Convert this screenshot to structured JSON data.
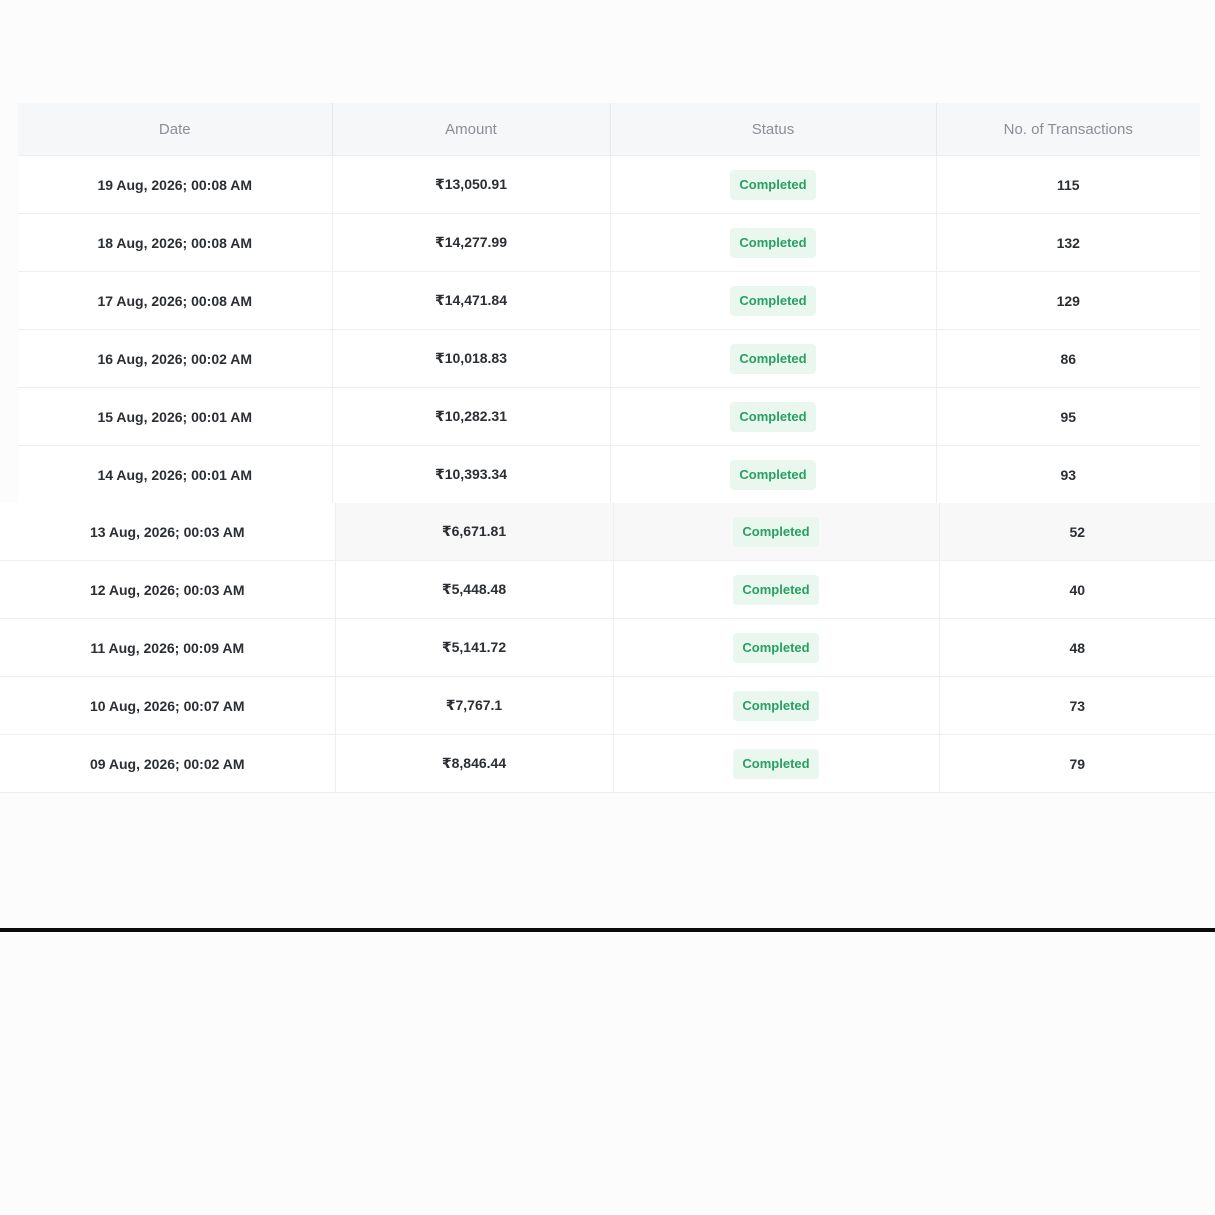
{
  "table": {
    "headers": {
      "date": "Date",
      "amount": "Amount",
      "status": "Status",
      "transactions": "No. of Transactions"
    },
    "rows": [
      {
        "date": "19 Aug, 2026; 00:08 AM",
        "amount": "₹13,050.91",
        "status": "Completed",
        "transactions": "115"
      },
      {
        "date": "18 Aug, 2026; 00:08 AM",
        "amount": "₹14,277.99",
        "status": "Completed",
        "transactions": "132"
      },
      {
        "date": "17 Aug, 2026; 00:08 AM",
        "amount": "₹14,471.84",
        "status": "Completed",
        "transactions": "129"
      },
      {
        "date": "16 Aug, 2026; 00:02 AM",
        "amount": "₹10,018.83",
        "status": "Completed",
        "transactions": "86"
      },
      {
        "date": "15 Aug, 2026; 00:01 AM",
        "amount": "₹10,282.31",
        "status": "Completed",
        "transactions": "95"
      },
      {
        "date": "14 Aug, 2026; 00:01 AM",
        "amount": "₹10,393.34",
        "status": "Completed",
        "transactions": "93"
      },
      {
        "date": "13 Aug, 2026; 00:03 AM",
        "amount": "₹6,671.81",
        "status": "Completed",
        "transactions": "52"
      },
      {
        "date": "12 Aug, 2026; 00:03 AM",
        "amount": "₹5,448.48",
        "status": "Completed",
        "transactions": "40"
      },
      {
        "date": "11 Aug, 2026; 00:09 AM",
        "amount": "₹5,141.72",
        "status": "Completed",
        "transactions": "48"
      },
      {
        "date": "10 Aug, 2026; 00:07 AM",
        "amount": "₹7,767.1",
        "status": "Completed",
        "transactions": "73"
      },
      {
        "date": "09 Aug, 2026; 00:02 AM",
        "amount": "₹8,846.44",
        "status": "Completed",
        "transactions": "79"
      }
    ]
  },
  "colors": {
    "status_completed_text": "#27a061",
    "status_completed_bg": "#e9f7ef",
    "header_bg": "#f6f7f8",
    "header_text": "#8a8f96",
    "cell_text": "#2b2f33"
  }
}
